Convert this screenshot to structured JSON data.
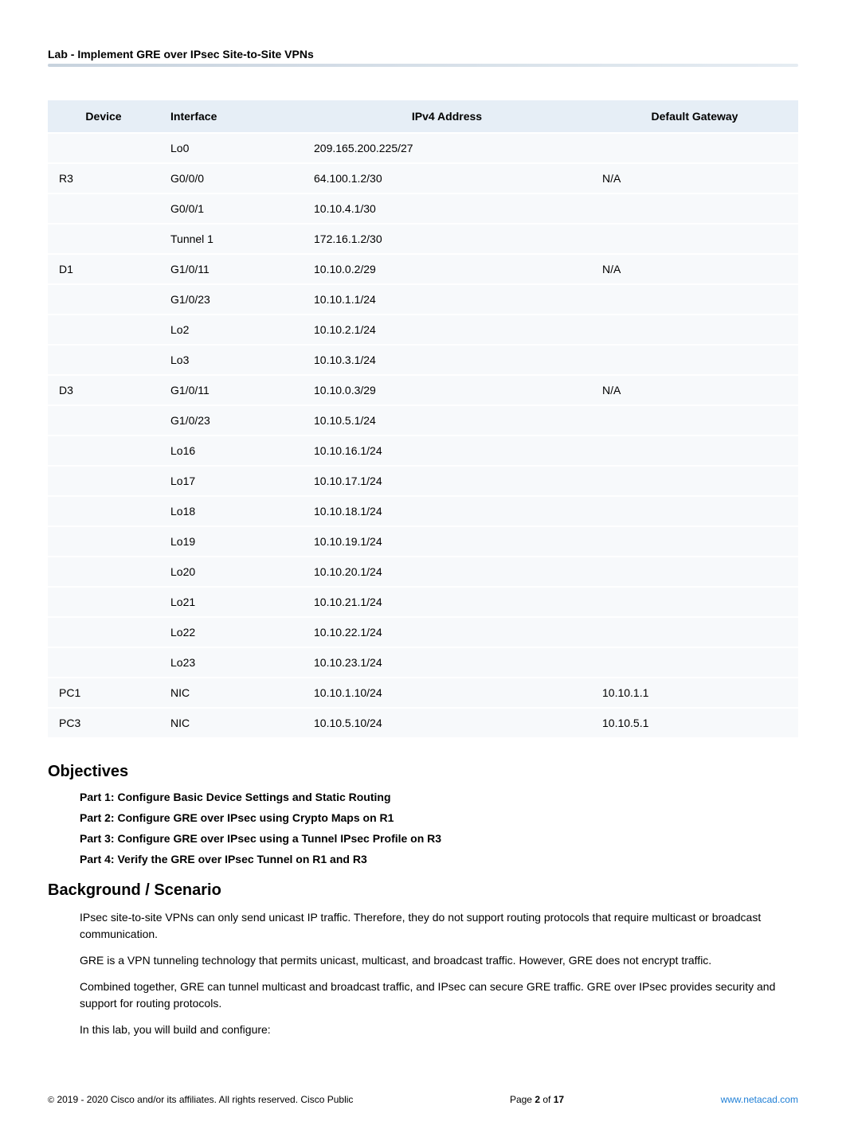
{
  "doc_title": "Lab - Implement GRE over IPsec Site-to-Site VPNs",
  "table": {
    "headers": {
      "device": "Device",
      "interface": "Interface",
      "ipv4": "IPv4 Address",
      "gw": "Default Gateway"
    },
    "rows": [
      {
        "device": "",
        "iface": "Lo0",
        "ipv4": "209.165.200.225/27",
        "gw": ""
      },
      {
        "device": "R3",
        "iface": "G0/0/0",
        "ipv4": "64.100.1.2/30",
        "gw": "N/A"
      },
      {
        "device": "",
        "iface": "G0/0/1",
        "ipv4": "10.10.4.1/30",
        "gw": ""
      },
      {
        "device": "",
        "iface": "Tunnel 1",
        "ipv4": "172.16.1.2/30",
        "gw": ""
      },
      {
        "device": "D1",
        "iface": "G1/0/11",
        "ipv4": "10.10.0.2/29",
        "gw": "N/A"
      },
      {
        "device": "",
        "iface": "G1/0/23",
        "ipv4": "10.10.1.1/24",
        "gw": ""
      },
      {
        "device": "",
        "iface": "Lo2",
        "ipv4": "10.10.2.1/24",
        "gw": ""
      },
      {
        "device": "",
        "iface": "Lo3",
        "ipv4": "10.10.3.1/24",
        "gw": ""
      },
      {
        "device": "D3",
        "iface": "G1/0/11",
        "ipv4": "10.10.0.3/29",
        "gw": "N/A"
      },
      {
        "device": "",
        "iface": "G1/0/23",
        "ipv4": "10.10.5.1/24",
        "gw": ""
      },
      {
        "device": "",
        "iface": "Lo16",
        "ipv4": "10.10.16.1/24",
        "gw": ""
      },
      {
        "device": "",
        "iface": "Lo17",
        "ipv4": "10.10.17.1/24",
        "gw": ""
      },
      {
        "device": "",
        "iface": "Lo18",
        "ipv4": "10.10.18.1/24",
        "gw": ""
      },
      {
        "device": "",
        "iface": "Lo19",
        "ipv4": "10.10.19.1/24",
        "gw": ""
      },
      {
        "device": "",
        "iface": "Lo20",
        "ipv4": "10.10.20.1/24",
        "gw": ""
      },
      {
        "device": "",
        "iface": "Lo21",
        "ipv4": "10.10.21.1/24",
        "gw": ""
      },
      {
        "device": "",
        "iface": "Lo22",
        "ipv4": "10.10.22.1/24",
        "gw": ""
      },
      {
        "device": "",
        "iface": "Lo23",
        "ipv4": "10.10.23.1/24",
        "gw": ""
      },
      {
        "device": "PC1",
        "iface": "NIC",
        "ipv4": "10.10.1.10/24",
        "gw": "10.10.1.1"
      },
      {
        "device": "PC3",
        "iface": "NIC",
        "ipv4": "10.10.5.10/24",
        "gw": "10.10.5.1"
      }
    ]
  },
  "sections": {
    "objectives": {
      "heading": "Objectives",
      "parts": [
        "Part 1: Configure Basic Device Settings and Static Routing",
        "Part 2: Configure GRE over IPsec using Crypto Maps on R1",
        "Part 3: Configure GRE over IPsec using a Tunnel IPsec Profile on R3",
        "Part 4: Verify the GRE over IPsec Tunnel on R1 and R3"
      ]
    },
    "background": {
      "heading": "Background / Scenario",
      "paras": [
        "IPsec site-to-site VPNs can only send unicast IP traffic. Therefore, they do not support routing protocols that require multicast or broadcast communication.",
        "GRE is a VPN tunneling technology that permits unicast, multicast, and broadcast traffic. However, GRE does not encrypt traffic.",
        "Combined together, GRE can tunnel multicast and broadcast traffic, and IPsec can secure GRE traffic. GRE over IPsec provides security and support for routing protocols.",
        "In this lab, you will build and configure:"
      ]
    }
  },
  "footer": {
    "copyright_prefix": "©",
    "copyright": " 2019 - 2020 Cisco and/or its affiliates. All rights reserved. Cisco Public",
    "page_prefix": "Page ",
    "page_num": "2",
    "page_of": " of ",
    "page_total": "17",
    "link": "www.netacad.com"
  }
}
